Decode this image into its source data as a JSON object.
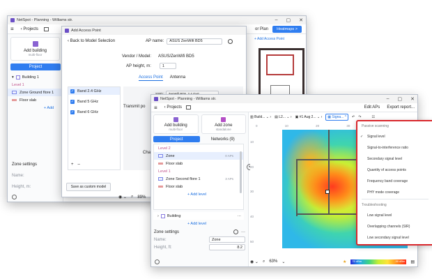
{
  "back_window": {
    "title": "NetSpot - Planning - Williams str.",
    "projects": "Projects",
    "add_building": "Add building",
    "add_building_sub": "multi-floor",
    "project_tab": "Project",
    "building": "Building 1",
    "level": "Level 1",
    "zone": "Zone Ground flore 1",
    "floor_slab": "Floor slab",
    "add_level": "+ Add",
    "zone_settings": "Zone settings",
    "name_label": "Name:",
    "height_label": "Height, m:",
    "plan_btn": "or Plan",
    "heatmaps_btn": "Heatmaps >",
    "add_ap": "Add Access Point"
  },
  "dialog": {
    "title": "Add Access Point",
    "back": "Back to Model Selection",
    "ap_name_label": "AP name:",
    "ap_name_value": "ASUS ZenWifi BD5",
    "vendor_label": "Vendor / Model:",
    "vendor_value": "ASUS/ZenWifi BD5",
    "height_label": "AP height, m:",
    "height_value": "1",
    "tabs": [
      "Access Point",
      "Antenna"
    ],
    "bands": [
      "Band 2.4 GHz",
      "Band 5 GHz",
      "Band 6 GHz"
    ],
    "transmit_label": "Transmit po",
    "chan_label": "Chan",
    "ssid_label": "SSID:",
    "ssid_value": "ZenWifi BD5_2.4 GHz",
    "save_custom": "Save as custom model",
    "zoom": "89%"
  },
  "front": {
    "title": "NetSpot - Planning - Williams str.",
    "projects": "Projects",
    "edit_aps": "Edit APs",
    "export_report": "Export report...",
    "add_building": "Add building",
    "add_building_sub": "multi-floor",
    "add_zone": "Add zone",
    "add_zone_sub": "standalone",
    "tab_project": "Project",
    "tab_networks": "Networks (9)",
    "level2": "Level 2",
    "zone": "Zone",
    "zone_aps": "0 APs",
    "floor_slab": "Floor slab",
    "level1": "Level 1",
    "zone_second": "Zone Second flore 1",
    "zone_second_aps": "3 APs",
    "floor_slab2": "Floor slab",
    "add_level": "+ Add level",
    "building": "Building",
    "add_level2": "+ Add level",
    "zone_settings": "Zone settings",
    "name_label": "Name:",
    "name_value": "Zone",
    "height_label": "Height, ft:",
    "height_value": "8.2",
    "zoom": "63%",
    "breadcrumb": [
      "Build...",
      "L2...",
      "#1 Aug 2...",
      "Signa..."
    ],
    "ruler_x": [
      "0",
      "10",
      "20",
      "30",
      "40",
      "50"
    ],
    "ruler_y": [
      "10",
      "20",
      "30",
      "40",
      "50"
    ],
    "legend_low": "75 dBm",
    "legend_high": "-30 dBm"
  },
  "menu": {
    "section1": "Passive scanning",
    "items1": [
      "Signal level",
      "Signal-to-interference ratio",
      "Secondary signal level",
      "Quantity of access points",
      "Frequency band coverage",
      "PHY mode coverage"
    ],
    "section2": "Troubleshooting",
    "items2": [
      "Low signal level",
      "Overlapping channels (SIR)",
      "Low secondary signal level"
    ],
    "accent": "#d9262b"
  }
}
